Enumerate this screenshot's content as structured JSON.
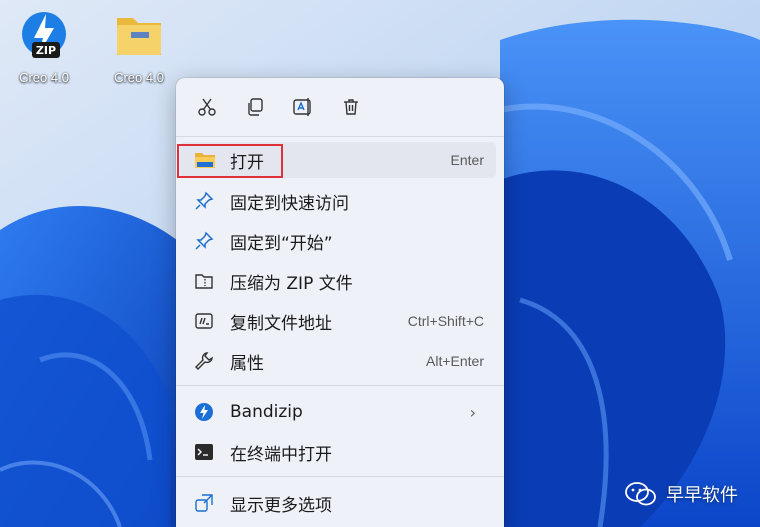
{
  "desktop": {
    "icons": [
      {
        "label": "Creo 4.0",
        "icon": "zip-archive-icon",
        "badge": "ZIP"
      },
      {
        "label": "Creo 4.0",
        "icon": "folder-icon"
      }
    ]
  },
  "context_menu": {
    "toolbar": [
      {
        "action": "cut",
        "icon": "scissors-icon"
      },
      {
        "action": "copy",
        "icon": "copy-icon"
      },
      {
        "action": "rename",
        "icon": "rename-icon"
      },
      {
        "action": "delete",
        "icon": "trash-icon"
      }
    ],
    "items": [
      {
        "label": "打开",
        "shortcut": "Enter",
        "icon": "folder-open-icon"
      },
      {
        "label": "固定到快速访问",
        "shortcut": "",
        "icon": "pin-icon"
      },
      {
        "label": "固定到“开始”",
        "shortcut": "",
        "icon": "pin-icon"
      },
      {
        "label": "压缩为 ZIP 文件",
        "shortcut": "",
        "icon": "zip-compress-icon"
      },
      {
        "label": "复制文件地址",
        "shortcut": "Ctrl+Shift+C",
        "icon": "copy-path-icon"
      },
      {
        "label": "属性",
        "shortcut": "Alt+Enter",
        "icon": "wrench-icon"
      },
      {
        "label": "Bandizip",
        "shortcut": "",
        "icon": "bandizip-icon",
        "submenu": true
      },
      {
        "label": "在终端中打开",
        "shortcut": "",
        "icon": "terminal-icon"
      },
      {
        "label": "显示更多选项",
        "shortcut": "",
        "icon": "more-options-icon"
      }
    ],
    "highlight_color": "#e0303a"
  },
  "watermark": {
    "text": "早早软件",
    "icon": "wechat-icon"
  }
}
